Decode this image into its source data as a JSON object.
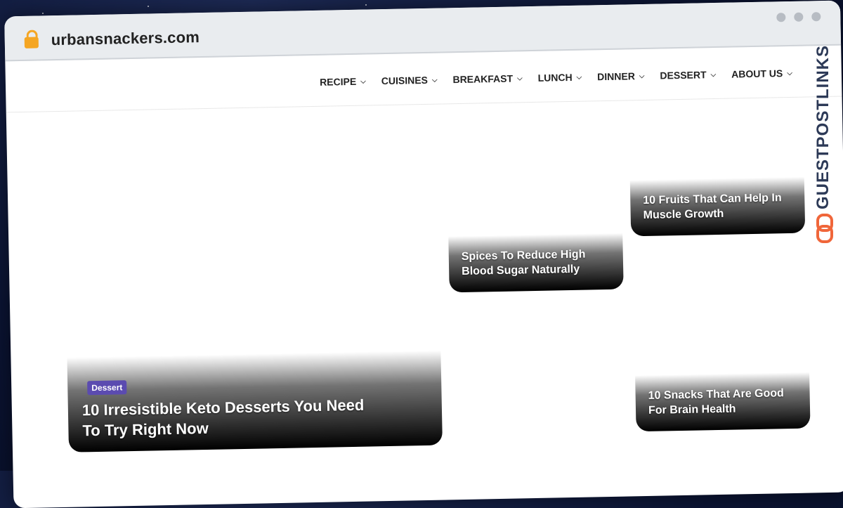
{
  "browser": {
    "url": "urbansnackers.com",
    "lock_icon": "lock-icon"
  },
  "nav": {
    "items": [
      {
        "label": "RECIPE"
      },
      {
        "label": "CUISINES"
      },
      {
        "label": "BREAKFAST"
      },
      {
        "label": "LUNCH"
      },
      {
        "label": "DINNER"
      },
      {
        "label": "DESSERT"
      },
      {
        "label": "ABOUT US"
      }
    ],
    "chevron_icon": "chevron-down-icon"
  },
  "cards": {
    "main": {
      "badge": "Dessert",
      "title": "10 Irresistible Keto Desserts You Need To Try Right Now"
    },
    "spices": {
      "title": "Spices To Reduce High Blood Sugar Naturally"
    },
    "fruits": {
      "title": "10 Fruits That Can Help In Muscle Growth"
    },
    "snacks": {
      "title": "10 Snacks That Are Good For Brain Health"
    }
  },
  "watermark": {
    "text": "GUESTPOSTLINKS",
    "icon": "chain-link-icon",
    "colors": {
      "text": "#2d3a57",
      "icon": "#f0663a"
    }
  },
  "colors": {
    "badge": "#5b4bb0",
    "lock": "#f5a623"
  }
}
